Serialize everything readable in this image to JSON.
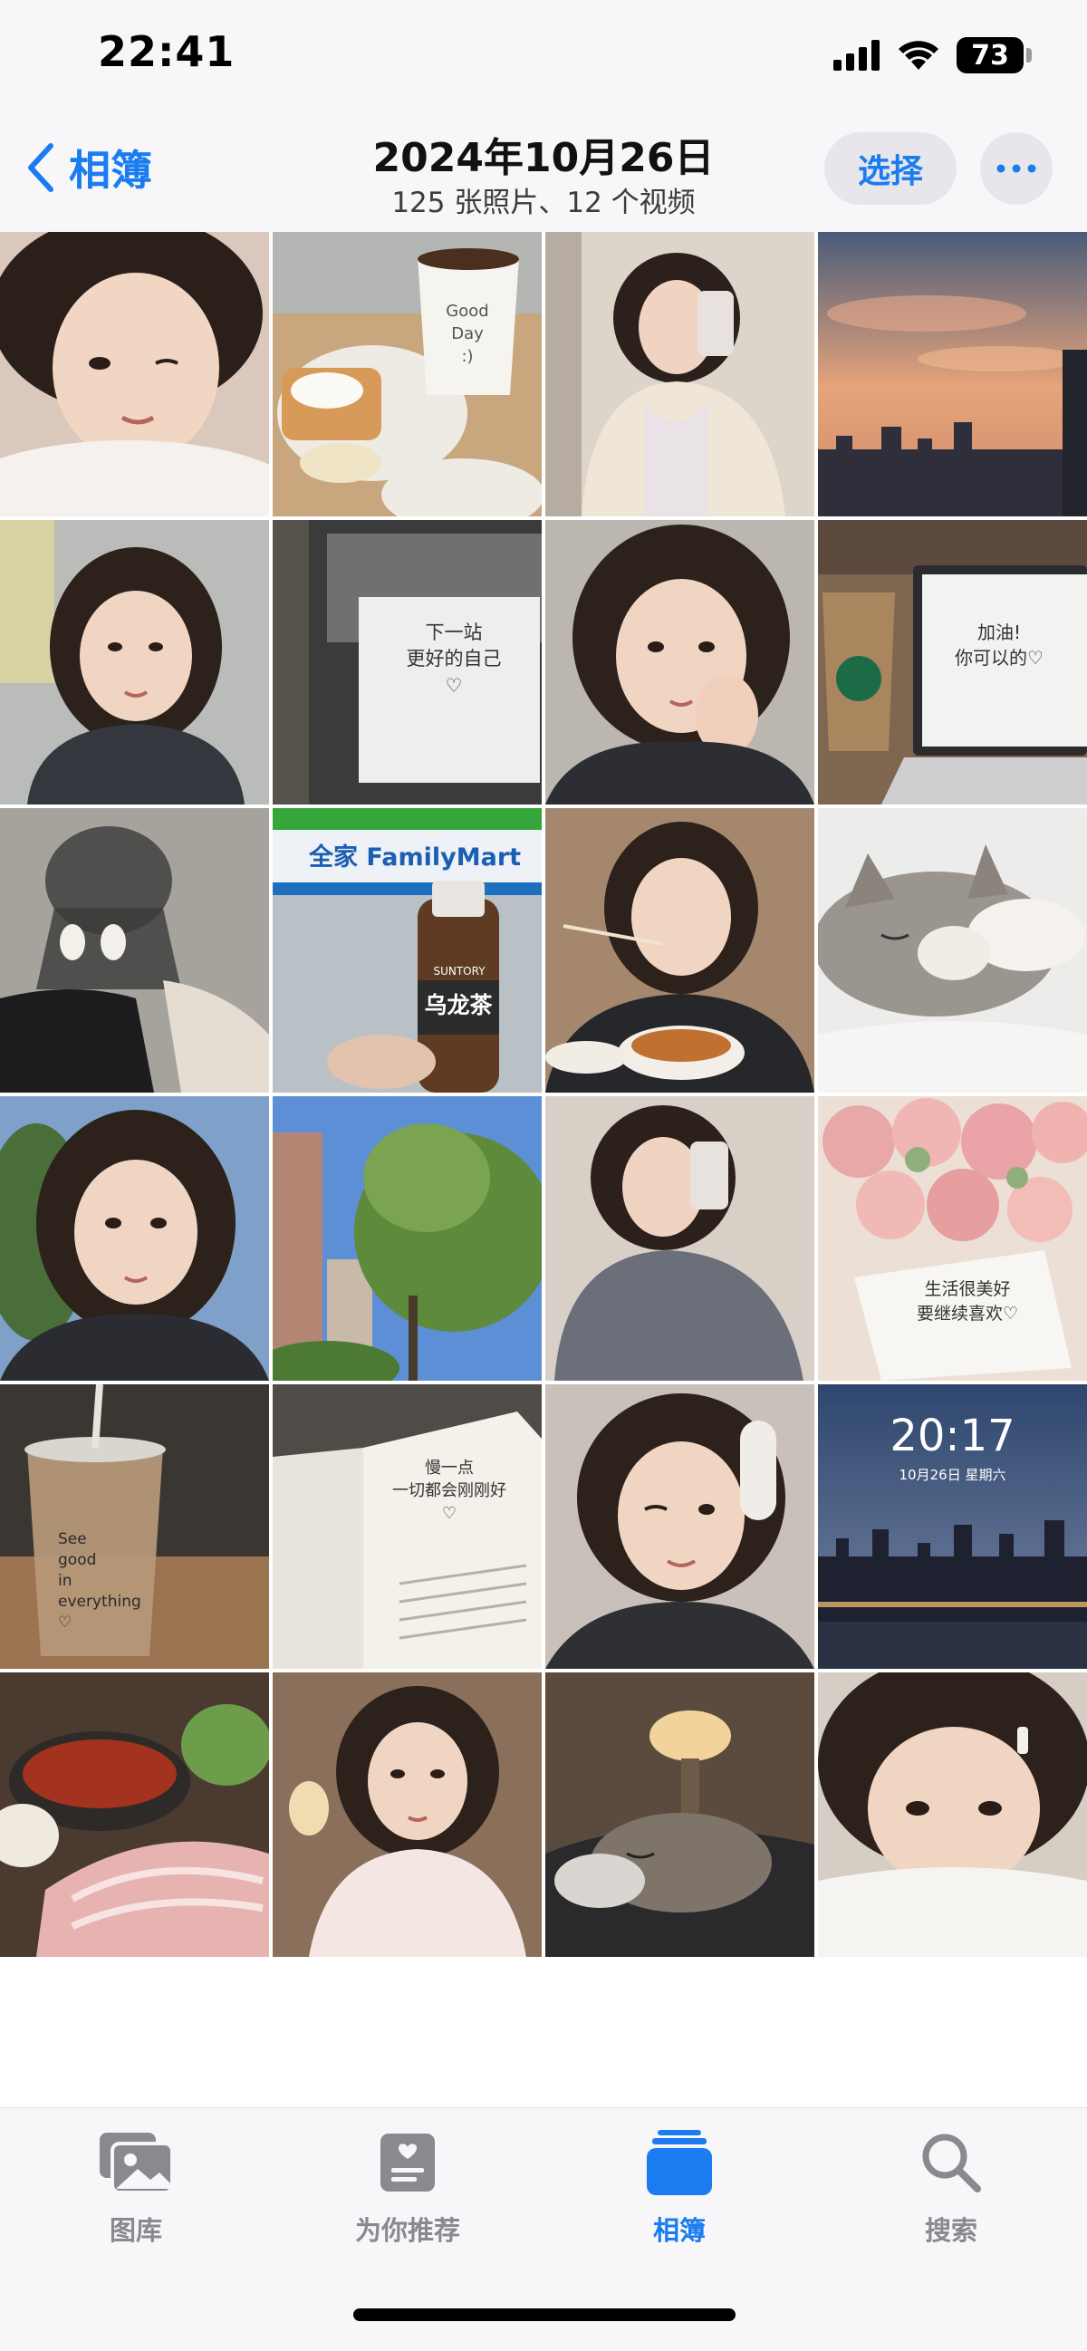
{
  "status_bar": {
    "time": "22:41",
    "battery": "73"
  },
  "nav": {
    "back_label": "相簿",
    "title": "2024年10月26日",
    "subtitle": "125 张照片、12 个视频",
    "select_label": "选择"
  },
  "photos": [
    {
      "desc": "selfie-winking-in-bed"
    },
    {
      "desc": "breakfast-with-coffee-cup",
      "text": "Good\nDay\n:)"
    },
    {
      "desc": "mirror-selfie-phone"
    },
    {
      "desc": "sunset-city-skyline"
    },
    {
      "desc": "selfie-subway-station"
    },
    {
      "desc": "subway-window-note",
      "text": "下一站\n更好的自己\n♡"
    },
    {
      "desc": "selfie-hand-on-cheek"
    },
    {
      "desc": "coffee-and-laptop",
      "text": "加油!\n你可以的♡"
    },
    {
      "desc": "shadow-and-shoes-on-ground"
    },
    {
      "desc": "familymart-tea-bottle",
      "sign": "全家 FamilyMart",
      "brand": "SUNTORY",
      "label": "乌龙茶"
    },
    {
      "desc": "eating-with-chopsticks"
    },
    {
      "desc": "sleeping-cat"
    },
    {
      "desc": "selfie-outdoors-trees"
    },
    {
      "desc": "trees-and-building-blue-sky"
    },
    {
      "desc": "mirror-selfie-cardigan"
    },
    {
      "desc": "pink-roses-with-card",
      "text": "生活很美好\n要继续喜欢♡"
    },
    {
      "desc": "iced-latte-cup",
      "text": "See\ngood\nin\neverything\n♡"
    },
    {
      "desc": "open-book-note",
      "text": "慢一点\n一切都会刚刚好\n♡"
    },
    {
      "desc": "selfie-headphones-winking"
    },
    {
      "desc": "lockscreen-night-city",
      "time": "20:17",
      "date": "10月26日 星期六"
    },
    {
      "desc": "hotpot-dinner"
    },
    {
      "desc": "selfie-bedroom-lamp"
    },
    {
      "desc": "cat-on-bed-lamp"
    },
    {
      "desc": "selfie-peeking-over-blanket"
    }
  ],
  "tabs": [
    {
      "label": "图库",
      "icon": "photos-icon",
      "active": false
    },
    {
      "label": "为你推荐",
      "icon": "for-you-icon",
      "active": false
    },
    {
      "label": "相簿",
      "icon": "albums-icon",
      "active": true
    },
    {
      "label": "搜索",
      "icon": "search-icon",
      "active": false
    }
  ],
  "colors": {
    "accent": "#1a7cf0",
    "bar_bg": "#f7f7f9",
    "inactive_tab": "#8a8a8e"
  }
}
